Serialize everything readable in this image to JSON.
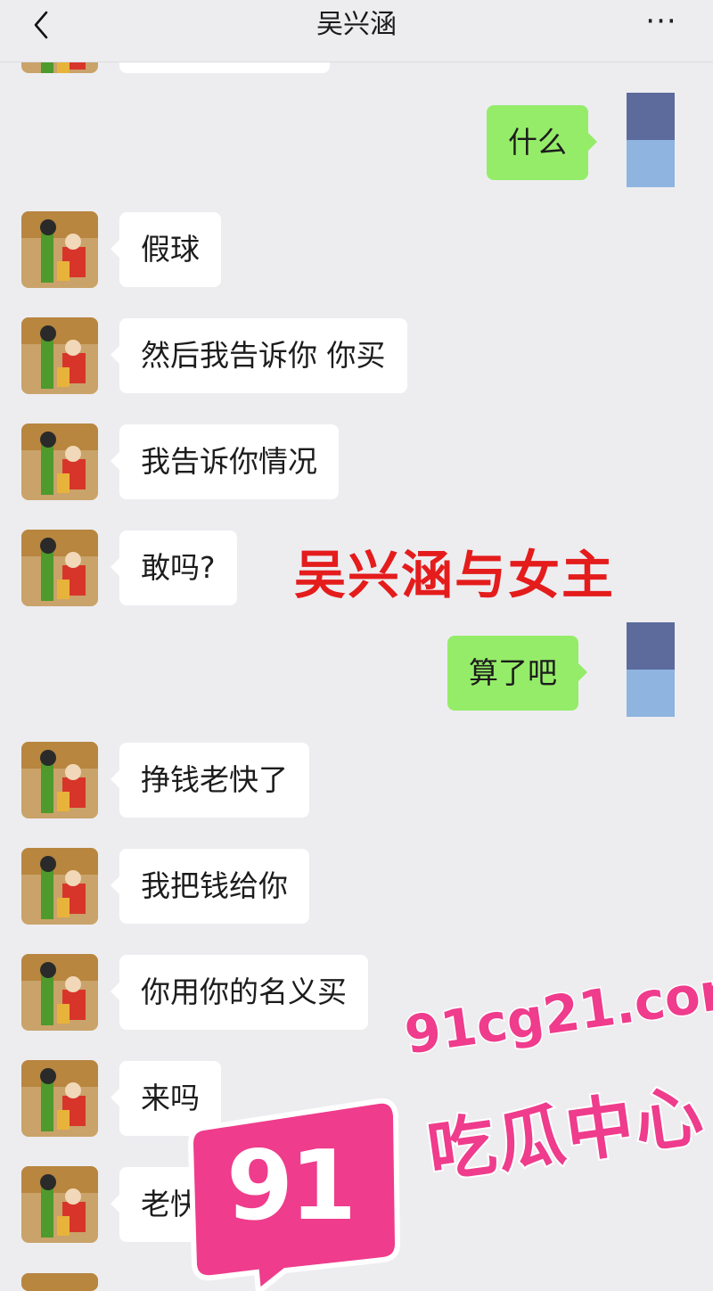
{
  "header": {
    "title": "吴兴涵",
    "back_icon": "chevron-left-icon",
    "more_icon": "more-dots-icon",
    "more_glyph": "···"
  },
  "messages": [
    {
      "side": "right",
      "text": "什么"
    },
    {
      "side": "left",
      "text": "假球"
    },
    {
      "side": "left",
      "text": "然后我告诉你 你买"
    },
    {
      "side": "left",
      "text": "我告诉你情况"
    },
    {
      "side": "left",
      "text": "敢吗?"
    },
    {
      "side": "right",
      "text": "算了吧"
    },
    {
      "side": "left",
      "text": "挣钱老快了"
    },
    {
      "side": "left",
      "text": "我把钱给你"
    },
    {
      "side": "left",
      "text": "你用你的名义买"
    },
    {
      "side": "left",
      "text": "来吗"
    },
    {
      "side": "left",
      "text": "老快了"
    }
  ],
  "overlay_caption": "吴兴涵与女主",
  "watermark": {
    "number": "91",
    "url": "91cg21.com",
    "name": "吃瓜中心"
  },
  "colors": {
    "background": "#ededf0",
    "sent_bubble": "#95ec69",
    "received_bubble": "#ffffff",
    "caption": "#e41c1c",
    "watermark": "#ef3c8c"
  }
}
